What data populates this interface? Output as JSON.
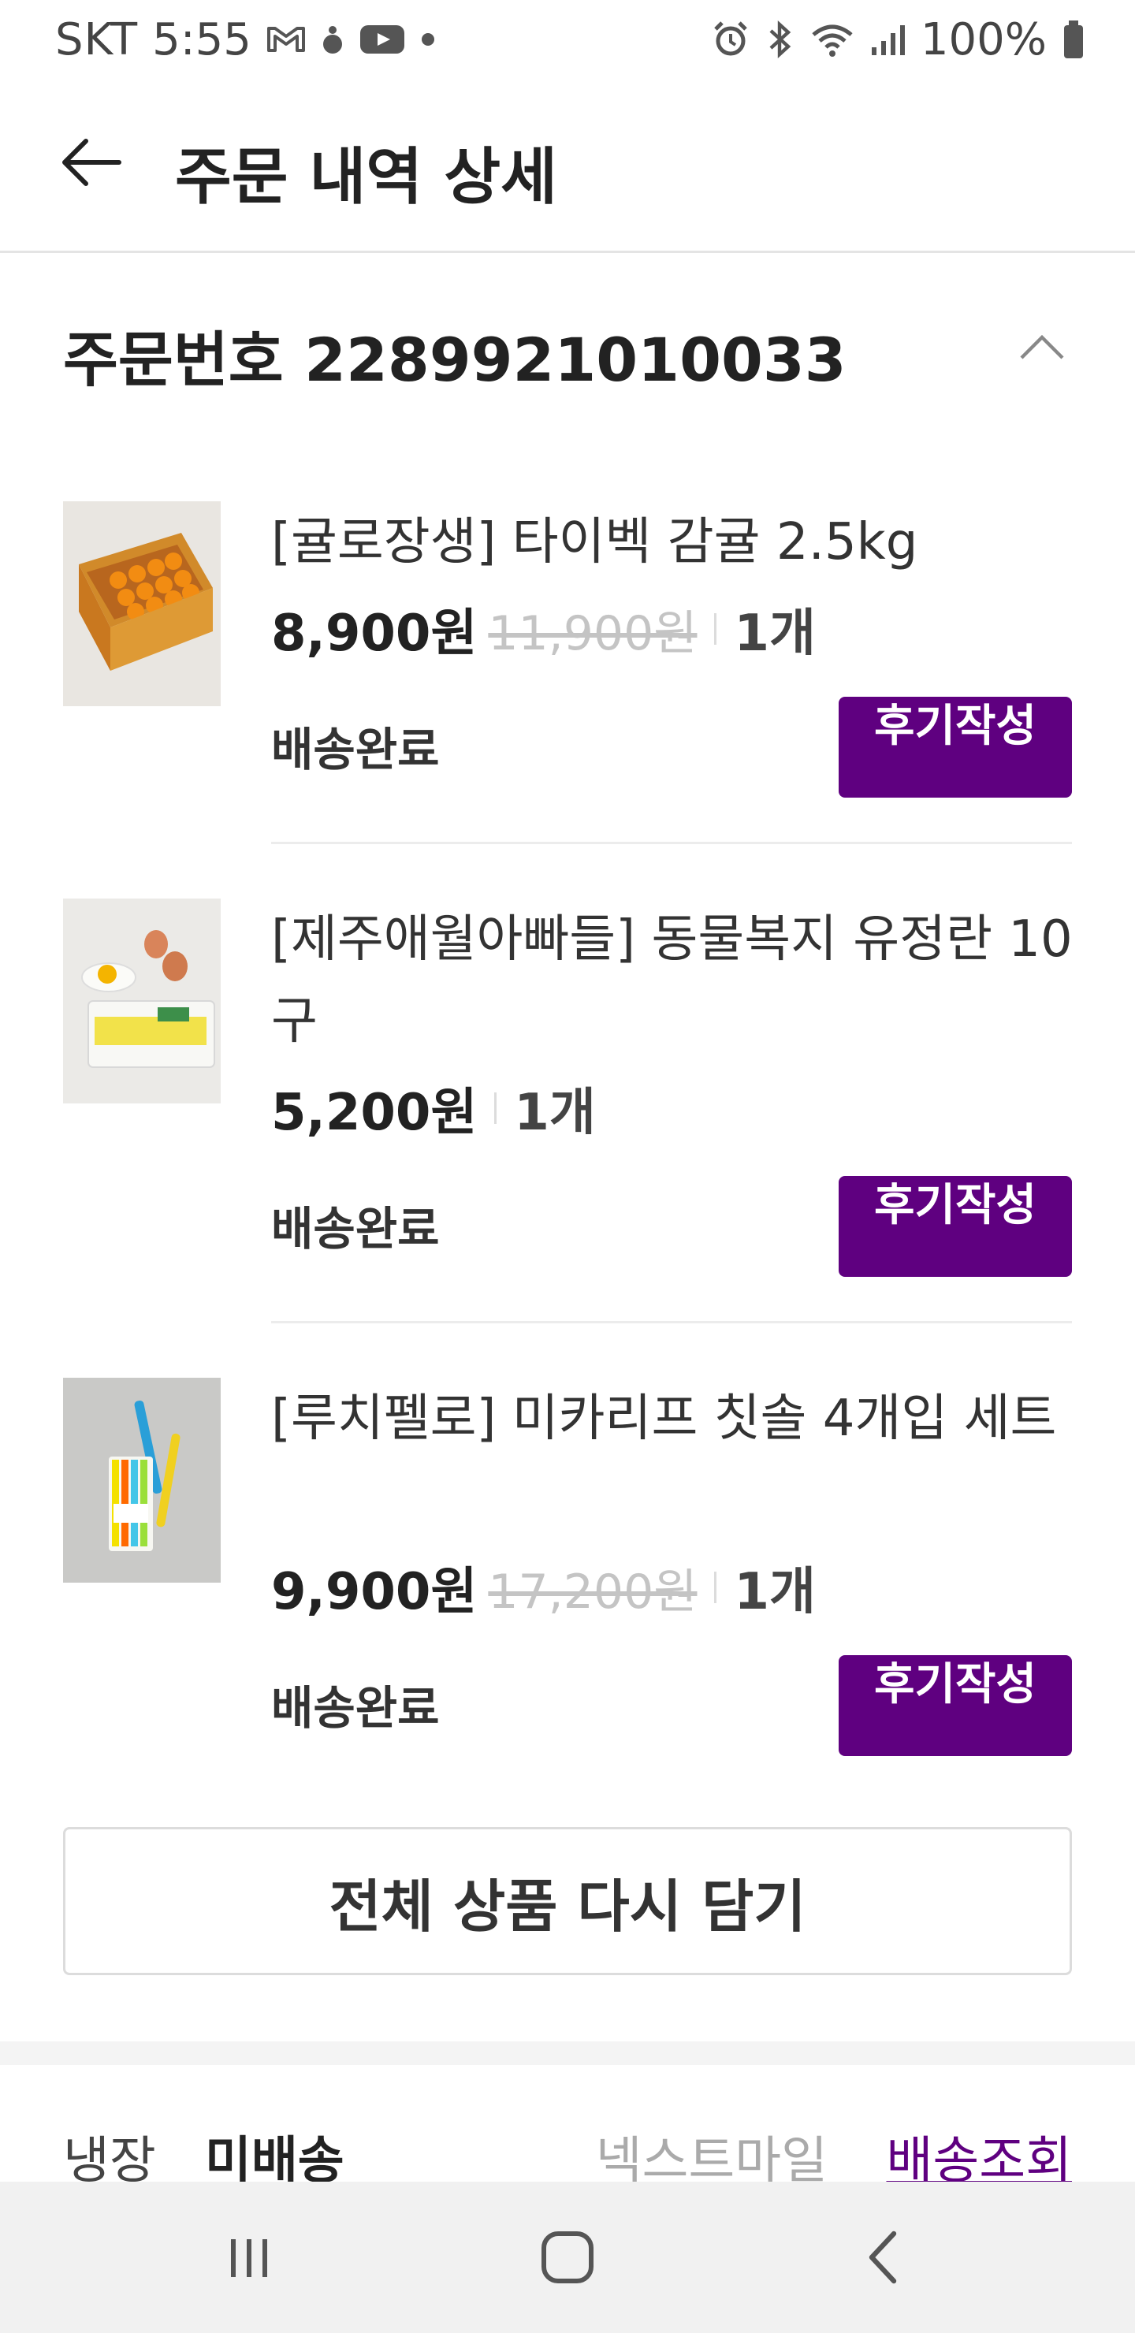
{
  "status_bar": {
    "carrier": "SKT",
    "time": "5:55",
    "battery": "100%"
  },
  "header": {
    "title": "주문 내역 상세"
  },
  "order": {
    "label": "주문번호 2289921010033"
  },
  "items": [
    {
      "name": "[귤로장생] 타이벡 감귤 2.5kg",
      "price": "8,900원",
      "original_price": "11,900원",
      "qty": "1개",
      "status": "배송완료",
      "review_label": "후기작성"
    },
    {
      "name": "[제주애월아빠들] 동물복지 유정란 10구",
      "price": "5,200원",
      "original_price": "",
      "qty": "1개",
      "status": "배송완료",
      "review_label": "후기작성"
    },
    {
      "name": "[루치펠로] 미카리프 칫솔 4개입 세트",
      "price": "9,900원",
      "original_price": "17,200원",
      "qty": "1개",
      "status": "배송완료",
      "review_label": "후기작성"
    }
  ],
  "reorder_label": "전체 상품 다시 담기",
  "delivery": {
    "type": "냉장",
    "status": "미배송",
    "courier": "넥스트마일",
    "track_label": "배송조회"
  },
  "colors": {
    "accent": "#5f0080",
    "strike": "#c4c4c4"
  }
}
